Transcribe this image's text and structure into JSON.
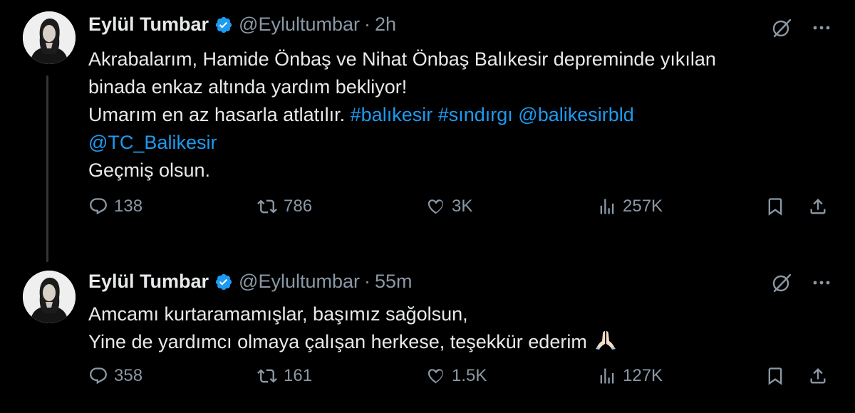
{
  "tweets": [
    {
      "name": "Eylül Tumbar",
      "handle": "@Eylultumbar",
      "separator": "·",
      "time": "2h",
      "lines": [
        [
          {
            "t": "Akrabalarım, Hamide Önbaş ve Nihat Önbaş Balıkesir depreminde yıkılan"
          }
        ],
        [
          {
            "t": "binada enkaz altında yardım bekliyor!"
          }
        ],
        [
          {
            "t": "Umarım en az hasarla atlatılır. "
          },
          {
            "t": "#balıkesir",
            "link": true
          },
          {
            "t": " "
          },
          {
            "t": "#sındırgı",
            "link": true
          },
          {
            "t": " "
          },
          {
            "t": "@balikesirbld",
            "link": true
          }
        ],
        [
          {
            "t": "@TC_Balikesir",
            "link": true
          }
        ],
        [
          {
            "t": "Geçmiş olsun."
          }
        ]
      ],
      "stats": {
        "replies": "138",
        "reposts": "786",
        "likes": "3K",
        "views": "257K"
      }
    },
    {
      "name": "Eylül Tumbar",
      "handle": "@Eylultumbar",
      "separator": "·",
      "time": "55m",
      "lines": [
        [
          {
            "t": "Amcamı kurtaramamışlar, başımız sağolsun,"
          }
        ],
        [
          {
            "t": "Yine de yardımcı olmaya çalışan herkese, teşekkür ederim"
          }
        ]
      ],
      "emoji": "folded-hands-emoji",
      "stats": {
        "replies": "358",
        "reposts": "161",
        "likes": "1.5K",
        "views": "127K"
      }
    }
  ],
  "colors": {
    "link": "#1d9bf0",
    "muted": "#8b98a5",
    "text": "#e7e9ea",
    "verified": "#1d9bf0",
    "background": "#000000"
  },
  "icons": [
    "verified-badge-icon",
    "grok-icon",
    "more-icon",
    "reply-icon",
    "repost-icon",
    "like-icon",
    "views-icon",
    "bookmark-icon",
    "share-icon"
  ]
}
